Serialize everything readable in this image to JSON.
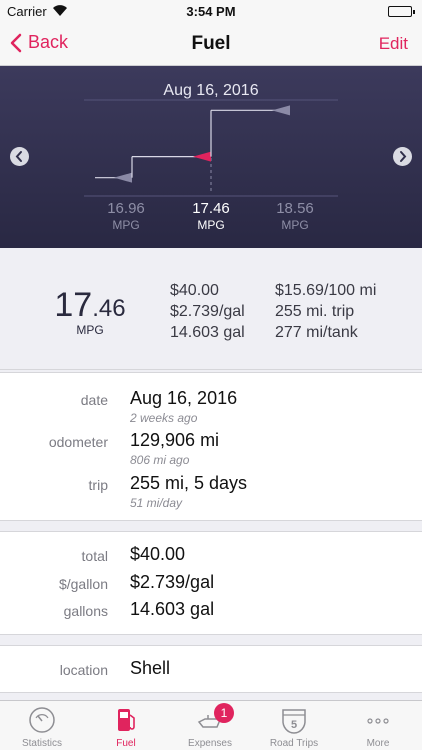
{
  "status_bar": {
    "carrier": "Carrier",
    "time": "3:54 PM"
  },
  "nav": {
    "back_label": "Back",
    "title": "Fuel",
    "edit_label": "Edit"
  },
  "chart": {
    "date": "Aug 16, 2016",
    "labels": [
      {
        "value": "16.96",
        "unit": "MPG"
      },
      {
        "value": "17.46",
        "unit": "MPG"
      },
      {
        "value": "18.56",
        "unit": "MPG"
      }
    ],
    "marker_color": "#e0245e"
  },
  "chart_data": {
    "type": "line",
    "x": [
      "16.96 MPG",
      "17.46 MPG",
      "18.56 MPG"
    ],
    "values": [
      16.96,
      17.46,
      18.56
    ],
    "selected_index": 1
  },
  "summary": {
    "mpg_whole": "17",
    "mpg_decimal": ".46",
    "mpg_unit": "MPG",
    "col1": [
      "$40.00",
      "$2.739/gal",
      "14.603 gal"
    ],
    "col2": [
      "$15.69/100 mi",
      "255 mi. trip",
      "277 mi/tank"
    ]
  },
  "details": {
    "date_label": "date",
    "date_value": "Aug 16, 2016",
    "date_sub": "2 weeks ago",
    "odometer_label": "odometer",
    "odometer_value": "129,906 mi",
    "odometer_sub": "806 mi ago",
    "trip_label": "trip",
    "trip_value": "255 mi, 5 days",
    "trip_sub": "51 mi/day"
  },
  "cost": {
    "total_label": "total",
    "total_value": "$40.00",
    "price_label": "$/gallon",
    "price_value": "$2.739/gal",
    "gallons_label": "gallons",
    "gallons_value": "14.603 gal"
  },
  "location": {
    "label": "location",
    "value": "Shell"
  },
  "tabs": [
    {
      "label": "Statistics",
      "icon": "gauge-icon"
    },
    {
      "label": "Fuel",
      "icon": "fuel-pump-icon"
    },
    {
      "label": "Expenses",
      "icon": "oil-can-icon",
      "badge": "1"
    },
    {
      "label": "Road Trips",
      "icon": "highway-shield-icon",
      "shield_number": "5"
    },
    {
      "label": "More",
      "icon": "more-dots-icon"
    }
  ],
  "colors": {
    "accent": "#e0245e",
    "chart_bg": "#2f2e4a"
  }
}
